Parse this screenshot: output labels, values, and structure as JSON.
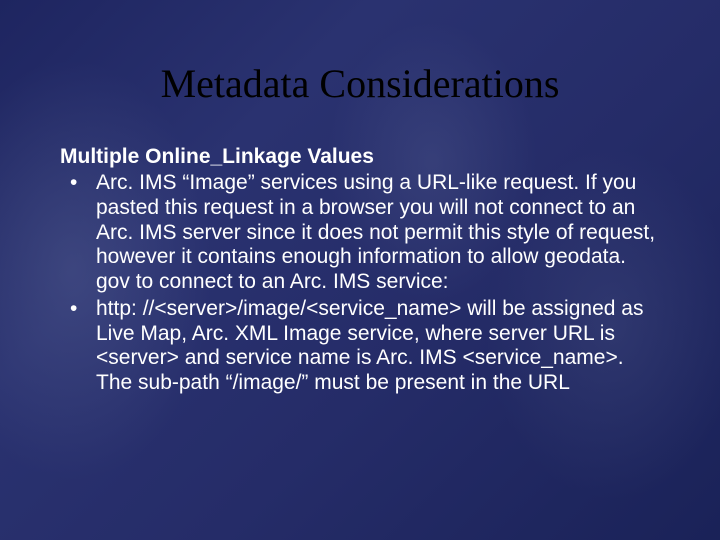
{
  "slide": {
    "title": "Metadata Considerations",
    "subheading": "Multiple Online_Linkage Values",
    "bullets": [
      "Arc. IMS “Image” services using a URL-like request. If you pasted this request in a browser you will not connect to an Arc. IMS server since it does not permit this style of request, however it contains enough information to allow geodata. gov to connect to an Arc. IMS service:",
      "http: //<server>/image/<service_name> will be assigned as Live Map, Arc. XML Image service, where server URL is <server> and service name is Arc. IMS <service_name>. The sub-path “/image/” must be present in the URL"
    ]
  }
}
